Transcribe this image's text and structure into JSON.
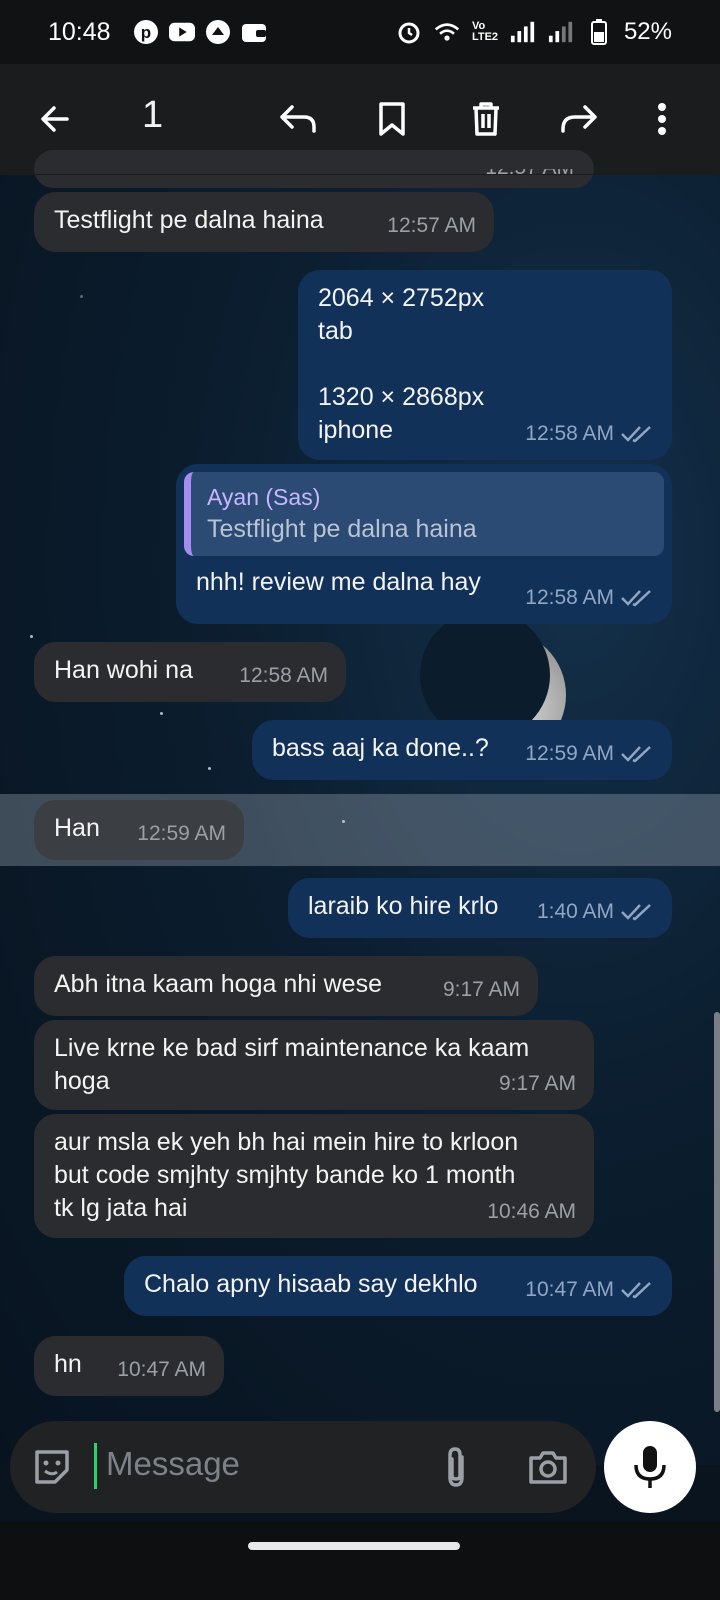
{
  "status_bar": {
    "time": "10:48",
    "battery": "52%",
    "network_label": "Vo LTE2"
  },
  "app_bar": {
    "selected_count": "1"
  },
  "messages": [
    {
      "text": "12:57 AM",
      "partial": true
    },
    {
      "direction": "in",
      "text": "Testflight pe dalna haina",
      "time": "12:57 AM"
    },
    {
      "direction": "out",
      "lines": [
        "2064 × 2752px",
        "tab",
        "",
        "1320 × 2868px",
        "iphone"
      ],
      "time": "12:58 AM"
    },
    {
      "direction": "out",
      "reply_to": {
        "name": "Ayan (Sas)",
        "text": "Testflight pe dalna haina"
      },
      "text": "nhh! review me dalna hay",
      "time": "12:58 AM"
    },
    {
      "direction": "in",
      "text": "Han wohi na",
      "time": "12:58 AM"
    },
    {
      "direction": "out",
      "text": "bass aaj ka done..?",
      "time": "12:59 AM"
    },
    {
      "direction": "in",
      "text": "Han",
      "time": "12:59 AM",
      "selected": true
    },
    {
      "direction": "out",
      "text": "laraib ko hire krlo",
      "time": "1:40 AM"
    },
    {
      "direction": "in",
      "text": "Abh itna kaam hoga nhi wese",
      "time": "9:17 AM"
    },
    {
      "direction": "in",
      "lines": [
        "Live krne ke bad sirf maintenance ka kaam",
        "hoga"
      ],
      "time": "9:17 AM"
    },
    {
      "direction": "in",
      "lines": [
        "aur msla ek yeh bh hai mein hire to krloon",
        "but code smjhty smjhty bande ko 1 month",
        "tk lg jata hai"
      ],
      "time": "10:46 AM"
    },
    {
      "direction": "out",
      "text": "Chalo apny hisaab say dekhlo",
      "time": "10:47 AM"
    },
    {
      "direction": "in",
      "text": "hn",
      "time": "10:47 AM"
    }
  ],
  "composer": {
    "placeholder": "Message"
  },
  "colors": {
    "incoming_bubble": "#2a2c2f",
    "outgoing_bubble": "#123159",
    "reply_accent": "#a68cf0",
    "cursor": "#2bd26b"
  }
}
